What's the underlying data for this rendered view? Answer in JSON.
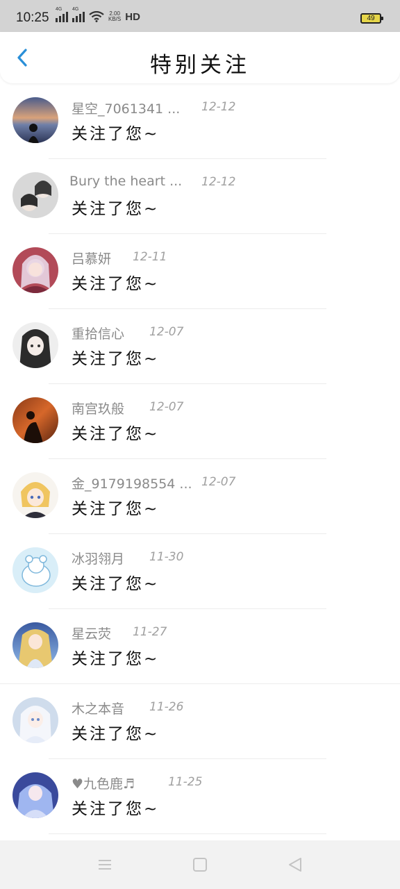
{
  "status_bar": {
    "time": "10:25",
    "network_label_1": "4G",
    "network_label_2": "4G",
    "speed_value": "2.00",
    "speed_unit": "KB/S",
    "hd_label": "HD",
    "battery_level": "49",
    "battery_color": "#e6d64a"
  },
  "header": {
    "back_icon": "chevron-left-icon",
    "title": "特别关注",
    "accent_color": "#2a8fd8"
  },
  "list": {
    "items": [
      {
        "name": "星空_7061341 ...",
        "date": "12-12",
        "message": "关注了您~"
      },
      {
        "name": "Bury the heart ...",
        "date": "12-12",
        "message": "关注了您~"
      },
      {
        "name": "吕慕妍",
        "date": "12-11",
        "message": "关注了您~"
      },
      {
        "name": "重拾信心",
        "date": "12-07",
        "message": "关注了您~"
      },
      {
        "name": "南宫玖般",
        "date": "12-07",
        "message": "关注了您~"
      },
      {
        "name": "金_9179198554 ...",
        "date": "12-07",
        "message": "关注了您~"
      },
      {
        "name": "冰羽翎月",
        "date": "11-30",
        "message": "关注了您~"
      },
      {
        "name": "星云荧",
        "date": "11-27",
        "message": "关注了您~"
      },
      {
        "name": "木之本音",
        "date": "11-26",
        "message": "关注了您~"
      },
      {
        "name": "♥九色鹿♬",
        "date": "11-25",
        "message": "关注了您~"
      }
    ]
  },
  "nav_bar": {
    "menu_icon": "menu-icon",
    "home_icon": "home-square-icon",
    "back_icon": "back-triangle-icon"
  }
}
